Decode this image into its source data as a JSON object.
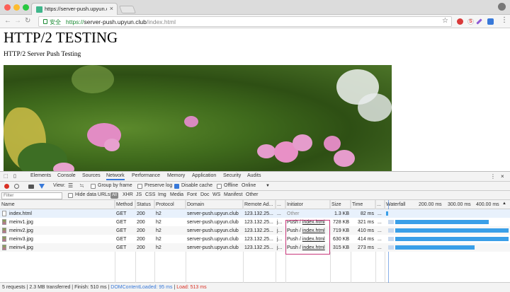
{
  "browser": {
    "tab_title": "https://server-push.upyun.club",
    "secure_label": "安全",
    "url_scheme": "https://",
    "url_host": "server-push.upyun.club",
    "url_path": "/index.html"
  },
  "page": {
    "title": "HTTP/2 TESTING",
    "subtitle": "HTTP/2 Server Push Testing"
  },
  "devtools": {
    "tabs": [
      "Elements",
      "Console",
      "Sources",
      "Network",
      "Performance",
      "Memory",
      "Application",
      "Security",
      "Audits"
    ],
    "selected_tab": "Network",
    "controls": {
      "view_label": "View:",
      "group_by_frame": "Group by frame",
      "preserve_log": "Preserve log",
      "disable_cache": "Disable cache",
      "offline": "Offline",
      "throttle": "Online"
    },
    "filter": {
      "placeholder": "Filter",
      "hide_data_urls": "Hide data URLs",
      "all": "All",
      "types": [
        "XHR",
        "JS",
        "CSS",
        "Img",
        "Media",
        "Font",
        "Doc",
        "WS",
        "Manifest",
        "Other"
      ]
    },
    "columns": [
      "Name",
      "Method",
      "Status",
      "Protocol",
      "Domain",
      "Remote Ad...",
      "...",
      "Initiator",
      "Size",
      "Time",
      "...",
      "Waterfall"
    ],
    "waterfall_ticks": [
      "200.00 ms",
      "300.00 ms",
      "400.00 ms"
    ],
    "rows": [
      {
        "name": "index.html",
        "method": "GET",
        "status": "200",
        "protocol": "h2",
        "domain": "server-push.upyun.club",
        "remote": "123.132.25...",
        "conn": "...",
        "initiator_prefix": "Other",
        "initiator_link": "",
        "size": "1.3 KB",
        "time": "82 ms",
        "icon": "doc"
      },
      {
        "name": "meinv1.jpg",
        "method": "GET",
        "status": "200",
        "protocol": "h2",
        "domain": "server-push.upyun.club",
        "remote": "123.132.25...",
        "conn": "j...",
        "initiator_prefix": "Push / ",
        "initiator_link": "index.html",
        "size": "728 KB",
        "time": "321 ms",
        "icon": "img"
      },
      {
        "name": "meinv2.jpg",
        "method": "GET",
        "status": "200",
        "protocol": "h2",
        "domain": "server-push.upyun.club",
        "remote": "123.132.25...",
        "conn": "j...",
        "initiator_prefix": "Push / ",
        "initiator_link": "index.html",
        "size": "719 KB",
        "time": "410 ms",
        "icon": "img"
      },
      {
        "name": "meinv3.jpg",
        "method": "GET",
        "status": "200",
        "protocol": "h2",
        "domain": "server-push.upyun.club",
        "remote": "123.132.25...",
        "conn": "j...",
        "initiator_prefix": "Push / ",
        "initiator_link": "index.html",
        "size": "630 KB",
        "time": "414 ms",
        "icon": "img"
      },
      {
        "name": "meinv4.jpg",
        "method": "GET",
        "status": "200",
        "protocol": "h2",
        "domain": "server-push.upyun.club",
        "remote": "123.132.25...",
        "conn": "j...",
        "initiator_prefix": "Push / ",
        "initiator_link": "index.html",
        "size": "315 KB",
        "time": "273 ms",
        "icon": "img"
      }
    ],
    "status": {
      "summary": "5 requests | 2.3 MB transferred | Finish: 510 ms | ",
      "dcl": "DOMContentLoaded: 95 ms",
      "sep": " | ",
      "load": "Load: 513 ms"
    }
  },
  "colors": {
    "accent": "#3879d9",
    "highlight": "#c8367a",
    "waterfall": "#3a9fe8"
  }
}
